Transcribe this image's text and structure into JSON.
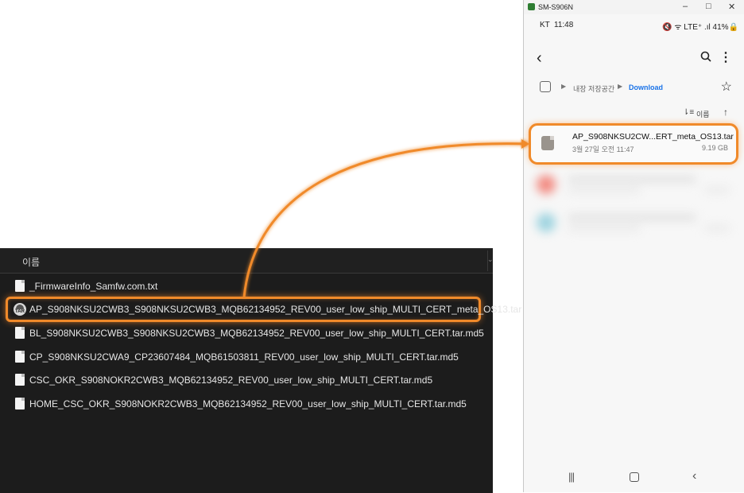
{
  "explorer": {
    "column_name": "이름",
    "files": [
      {
        "name": "_FirmwareInfo_Samfw.com.txt",
        "icon": "text-file-icon"
      },
      {
        "name": "AP_S908NKSU2CWB3_S908NKSU2CWB3_MQB62134952_REV00_user_low_ship_MULTI_CERT_meta_OS13.tar",
        "icon": "tar-archive-icon",
        "tar_label": "TAR"
      },
      {
        "name": "BL_S908NKSU2CWB3_S908NKSU2CWB3_MQB62134952_REV00_user_low_ship_MULTI_CERT.tar.md5",
        "icon": "file-icon"
      },
      {
        "name": "CP_S908NKSU2CWA9_CP23607484_MQB61503811_REV00_user_low_ship_MULTI_CERT.tar.md5",
        "icon": "file-icon"
      },
      {
        "name": "CSC_OKR_S908NOKR2CWB3_MQB62134952_REV00_user_low_ship_MULTI_CERT.tar.md5",
        "icon": "file-icon"
      },
      {
        "name": "HOME_CSC_OKR_S908NOKR2CWB3_MQB62134952_REV00_user_low_ship_MULTI_CERT.tar.md5",
        "icon": "file-icon"
      }
    ]
  },
  "phone": {
    "window_title": "SM-S906N",
    "window_buttons": {
      "minimize": "–",
      "maximize": "□",
      "close": "✕"
    },
    "status": {
      "carrier": "KT",
      "time": "11:48",
      "icons": "🔇 ᯤ LTE⁺ .ıl 41%🔒"
    },
    "breadcrumb": {
      "root": "내장 저장공간",
      "current": "Download"
    },
    "sort_label": "이름",
    "file": {
      "name": "AP_S908NKSU2CW...ERT_meta_OS13.tar",
      "date": "3월 27일 오전 11:47",
      "size": "9.19 GB"
    },
    "nav": {
      "recents": "|||",
      "back": "‹"
    }
  },
  "colors": {
    "highlight": "#f08a2a",
    "link": "#1a73e8",
    "explorer_bg": "#1c1c1c"
  }
}
